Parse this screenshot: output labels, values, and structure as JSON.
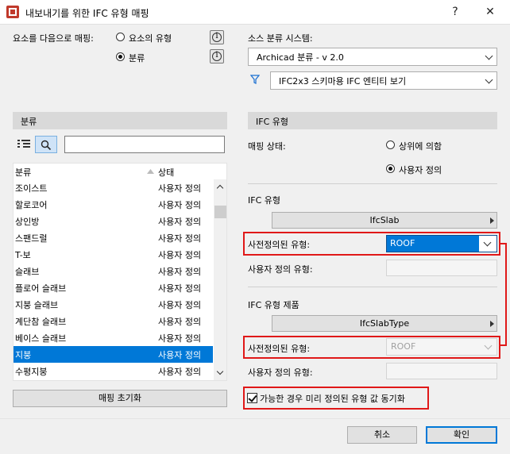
{
  "window": {
    "title": "내보내기를 위한 IFC 유형 매핑",
    "help": "?",
    "close": "✕"
  },
  "mapping": {
    "label": "요소를 다음으로 매핑:",
    "option_element_type": "요소의 유형",
    "option_classification": "분류",
    "info_glyph": "i"
  },
  "source": {
    "label": "소스 분류 시스템:",
    "system_value": "Archicad 분류 - v 2.0",
    "filter_value": "IFC2x3 스키마용 IFC 엔티티 보기"
  },
  "left_panel": {
    "header": "분류",
    "search_value": "",
    "columns": [
      "분류",
      "상태"
    ],
    "rows": [
      {
        "name": "조이스트",
        "status": "사용자 정의",
        "selected": false
      },
      {
        "name": "할로코어",
        "status": "사용자 정의",
        "selected": false
      },
      {
        "name": "상인방",
        "status": "사용자 정의",
        "selected": false
      },
      {
        "name": "스팬드럴",
        "status": "사용자 정의",
        "selected": false
      },
      {
        "name": "T-보",
        "status": "사용자 정의",
        "selected": false
      },
      {
        "name": "슬래브",
        "status": "사용자 정의",
        "selected": false
      },
      {
        "name": "플로어 슬래브",
        "status": "사용자 정의",
        "selected": false
      },
      {
        "name": "지붕 슬래브",
        "status": "사용자 정의",
        "selected": false
      },
      {
        "name": "계단참 슬래브",
        "status": "사용자 정의",
        "selected": false
      },
      {
        "name": "베이스 슬래브",
        "status": "사용자 정의",
        "selected": false
      },
      {
        "name": "지붕",
        "status": "사용자 정의",
        "selected": true
      },
      {
        "name": "수평지붕",
        "status": "사용자 정의",
        "selected": false
      }
    ],
    "reset_button": "매핑 초기화"
  },
  "right_panel": {
    "header": "IFC 유형",
    "mapping_status_label": "매핑 상태:",
    "option_by_parent": "상위에 의함",
    "option_custom": "사용자 정의",
    "ifc_type_label": "IFC 유형",
    "ifc_type_value": "IfcSlab",
    "predefined_label_1": "사전정의된 유형:",
    "predefined_value_1": "ROOF",
    "user_defined_label_1": "사용자 정의 유형:",
    "user_defined_value_1": "",
    "ifc_product_label": "IFC 유형 제품",
    "ifc_product_value": "IfcSlabType",
    "predefined_label_2": "사전정의된 유형:",
    "predefined_value_2": "ROOF",
    "user_defined_label_2": "사용자 정의 유형:",
    "user_defined_value_2": "",
    "sync_checkbox_label": "가능한 경우 미리 정의된 유형 값 동기화",
    "sync_checked": true
  },
  "footer": {
    "cancel": "취소",
    "ok": "확인"
  },
  "colors": {
    "selection": "#0078d7",
    "highlight_red": "#e01818",
    "funnel": "#1a6fd1"
  }
}
